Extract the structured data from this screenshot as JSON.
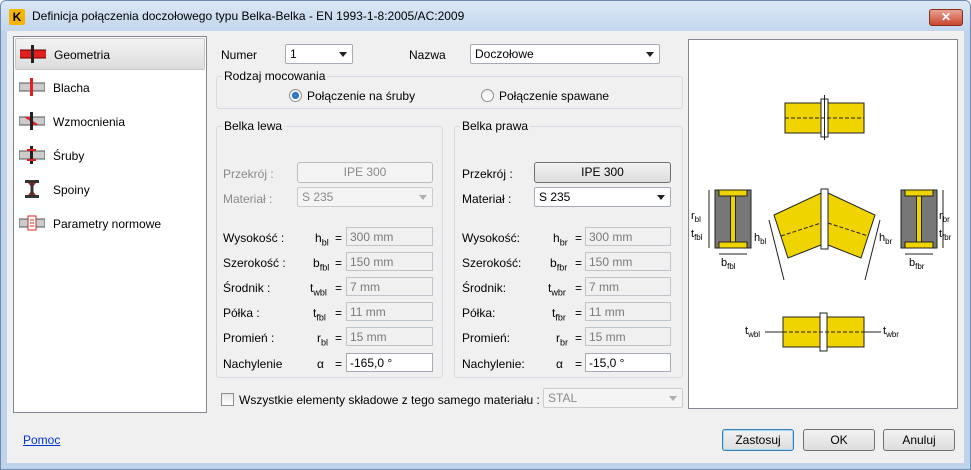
{
  "window": {
    "title": "Definicja połączenia doczołowego typu Belka-Belka - EN 1993-1-8:2005/AC:2009",
    "app_icon_letter": "K",
    "close_glyph": "✕"
  },
  "sidebar": {
    "items": [
      {
        "label": "Geometria",
        "icon": "beam-red-icon",
        "selected": true
      },
      {
        "label": "Blacha",
        "icon": "plate-icon"
      },
      {
        "label": "Wzmocnienia",
        "icon": "stiffener-icon"
      },
      {
        "label": "Śruby",
        "icon": "bolts-icon"
      },
      {
        "label": "Spoiny",
        "icon": "welds-icon"
      },
      {
        "label": "Parametry normowe",
        "icon": "code-parameters-icon"
      }
    ]
  },
  "top": {
    "numer_label": "Numer",
    "numer_value": "1",
    "nazwa_label": "Nazwa",
    "nazwa_value": "Doczołowe"
  },
  "mounting": {
    "label": "Rodzaj mocowania",
    "option1": "Połączenie na śruby",
    "option2": "Połączenie spawane",
    "selected": "option1"
  },
  "left_beam": {
    "title": "Belka lewa",
    "section_label": "Przekrój :",
    "section_value": "IPE 300",
    "material_label": "Materiał :",
    "material_value": "S 235",
    "rows": [
      {
        "label": "Wysokość :",
        "sym": "h",
        "sub": "bl",
        "eq": "=",
        "value": "300 mm"
      },
      {
        "label": "Szerokość :",
        "sym": "b",
        "sub": "fbl",
        "eq": "=",
        "value": "150 mm"
      },
      {
        "label": "Środnik :",
        "sym": "t",
        "sub": "wbl",
        "eq": "=",
        "value": "7 mm"
      },
      {
        "label": "Półka :",
        "sym": "t",
        "sub": "fbl",
        "eq": "=",
        "value": "11 mm"
      },
      {
        "label": "Promień :",
        "sym": "r",
        "sub": "bl",
        "eq": "=",
        "value": "15 mm"
      }
    ],
    "angle_label": "Nachylenie",
    "angle_sym": "α",
    "angle_eq": "=",
    "angle_value": "-165,0 °"
  },
  "right_beam": {
    "title": "Belka prawa",
    "section_label": "Przekrój :",
    "section_value": "IPE 300",
    "material_label": "Materiał :",
    "material_value": "S 235",
    "rows": [
      {
        "label": "Wysokość:",
        "sym": "h",
        "sub": "br",
        "eq": "=",
        "value": "300 mm"
      },
      {
        "label": "Szerokość:",
        "sym": "b",
        "sub": "fbr",
        "eq": "=",
        "value": "150 mm"
      },
      {
        "label": "Środnik:",
        "sym": "t",
        "sub": "wbr",
        "eq": "=",
        "value": "7 mm"
      },
      {
        "label": "Półka:",
        "sym": "t",
        "sub": "fbr",
        "eq": "=",
        "value": "11 mm"
      },
      {
        "label": "Promień:",
        "sym": "r",
        "sub": "br",
        "eq": "=",
        "value": "15 mm"
      }
    ],
    "angle_label": "Nachylenie:",
    "angle_sym": "α",
    "angle_eq": "=",
    "angle_value": "-15,0 °"
  },
  "same_material": {
    "label": "Wszystkie elementy składowe z tego samego materiału :",
    "checked": false,
    "value": "STAL"
  },
  "preview": {
    "labels": {
      "rbl": "r",
      "rbl_sub": "bl",
      "tfbl": "t",
      "tfbl_sub": "fbl",
      "hbl": "h",
      "hbl_sub": "bl",
      "hbr": "h",
      "hbr_sub": "br",
      "rbr": "r",
      "rbr_sub": "br",
      "tfbr": "t",
      "tfbr_sub": "fbr",
      "bfbl": "b",
      "bfbl_sub": "fbl",
      "bfbr": "b",
      "bfbr_sub": "fbr",
      "twbl": "t",
      "twbl_sub": "wbl",
      "twbr": "t",
      "twbr_sub": "wbr"
    }
  },
  "footer": {
    "help": "Pomoc",
    "apply": "Zastosuj",
    "ok": "OK",
    "cancel": "Anuluj"
  },
  "colors": {
    "steel": "#f0d400",
    "selection_red": "#e02020",
    "link": "#0033cc"
  }
}
